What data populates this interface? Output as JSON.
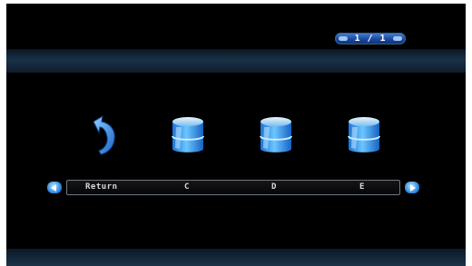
{
  "pager": {
    "text": "1 / 1"
  },
  "items": [
    {
      "label": "Return",
      "icon": "return-arrow-icon"
    },
    {
      "label": "C",
      "icon": "drive-icon"
    },
    {
      "label": "D",
      "icon": "drive-icon"
    },
    {
      "label": "E",
      "icon": "drive-icon"
    }
  ],
  "nav": {
    "prev_icon": "left-arrow-icon",
    "next_icon": "right-arrow-icon"
  },
  "colors": {
    "background": "#000000",
    "accent": "#1e7fd8",
    "band": "#1a3146"
  }
}
